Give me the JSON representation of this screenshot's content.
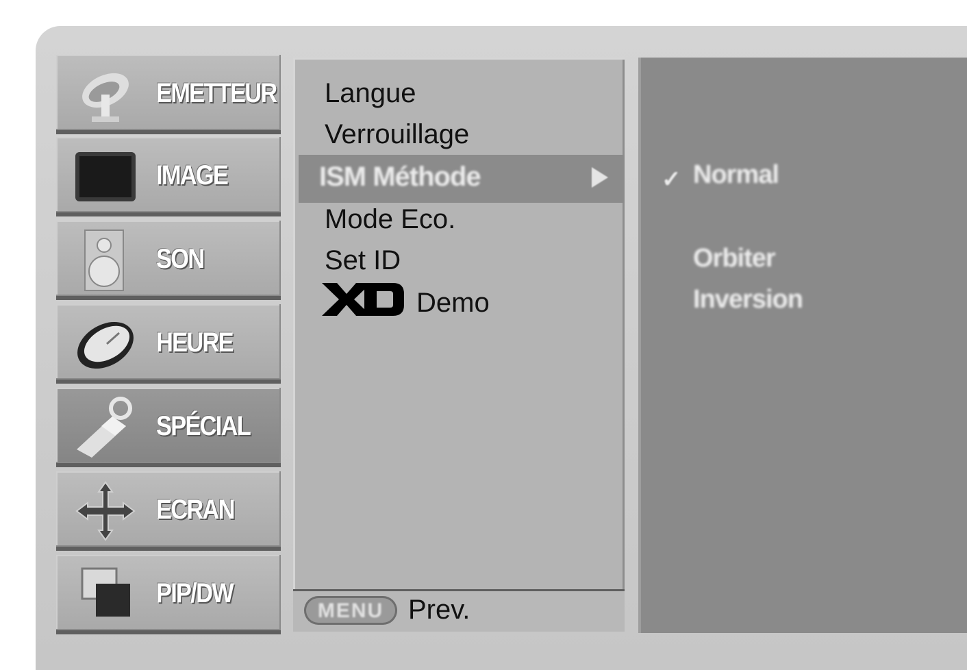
{
  "categories": [
    {
      "label": "EMETTEUR",
      "icon": "antenna-icon"
    },
    {
      "label": "IMAGE",
      "icon": "picture-icon"
    },
    {
      "label": "SON",
      "icon": "speaker-icon"
    },
    {
      "label": "HEURE",
      "icon": "clock-icon"
    },
    {
      "label": "SPÉCIAL",
      "icon": "key-icon"
    },
    {
      "label": "ECRAN",
      "icon": "move-arrows-icon"
    },
    {
      "label": "PIP/DW",
      "icon": "pip-icon"
    }
  ],
  "selected_category": "SPÉCIAL",
  "menu": {
    "items": [
      "Langue",
      "Verrouillage",
      "ISM Méthode",
      "Mode Eco.",
      "Set ID"
    ],
    "highlighted": "ISM Méthode",
    "xd_demo_label": "Demo"
  },
  "options": {
    "items": [
      "Normal",
      "Orbiter",
      "Inversion"
    ],
    "checked": "Normal"
  },
  "footer": {
    "menu_key": "MENU",
    "prev_label": "Prev."
  },
  "colors": {
    "frame": "#cccccc",
    "category": "#b0b0b0",
    "highlight": "#8b8b8b",
    "right_panel": "#8a8a8a"
  }
}
